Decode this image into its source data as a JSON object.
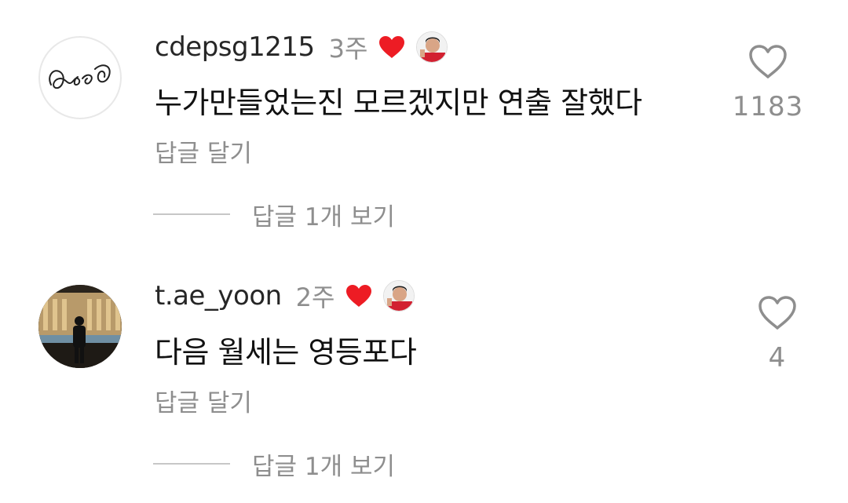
{
  "comments": [
    {
      "username": "cdepsg1215",
      "time": "3주",
      "text": "누가만들었는진 모르겠지만 연출 잘했다",
      "reply_label": "답글 달기",
      "view_replies_label": "답글 1개 보기",
      "like_count": "1183",
      "liked_by_creator": true
    },
    {
      "username": "t.ae_yoon",
      "time": "2주",
      "text": "다음 월세는 영등포다",
      "reply_label": "답글 달기",
      "view_replies_label": "답글 1개 보기",
      "like_count": "4",
      "liked_by_creator": true
    }
  ],
  "icons": {
    "creator_heart": "heart-filled-icon",
    "like": "heart-outline-icon"
  },
  "colors": {
    "heart_red": "#ed1c24",
    "muted_text": "#8e8e8e"
  }
}
